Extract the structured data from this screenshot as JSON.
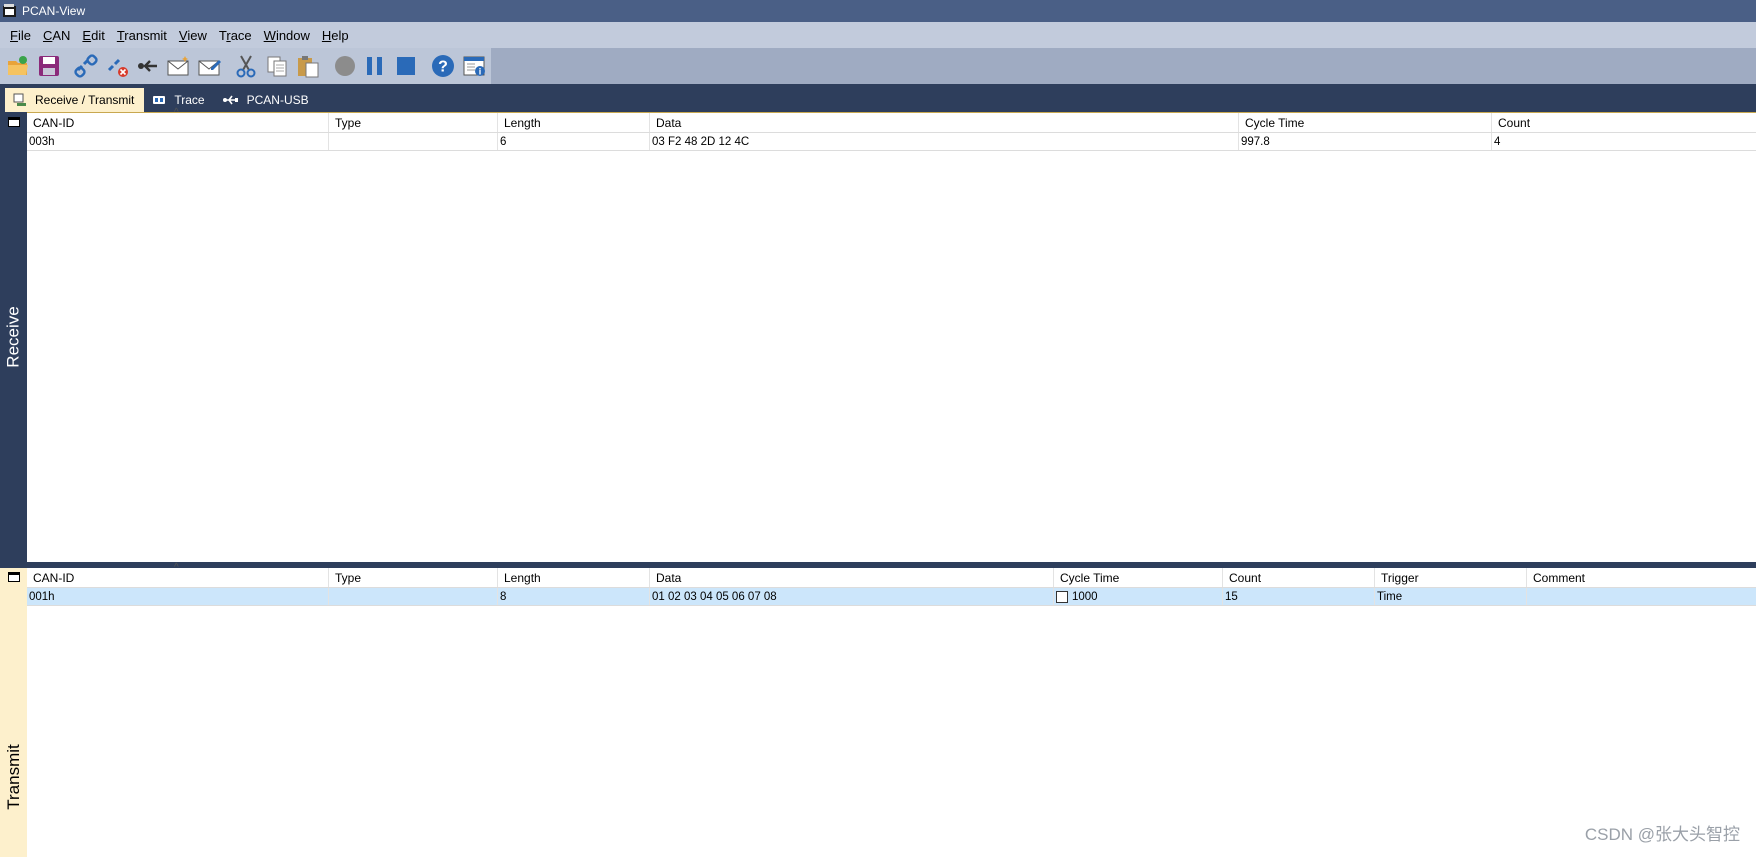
{
  "window": {
    "title": "PCAN-View"
  },
  "menu": [
    {
      "label": "File",
      "mnemonic": "F",
      "rest": "ile"
    },
    {
      "label": "CAN",
      "mnemonic": "C",
      "rest": "AN"
    },
    {
      "label": "Edit",
      "mnemonic": "E",
      "rest": "dit"
    },
    {
      "label": "Transmit",
      "mnemonic": "T",
      "rest": "ransmit"
    },
    {
      "label": "View",
      "mnemonic": "V",
      "rest": "iew"
    },
    {
      "label": "Trace",
      "mnemonic": "r",
      "prefix": "T",
      "rest": "ace"
    },
    {
      "label": "Window",
      "mnemonic": "W",
      "rest": "indow"
    },
    {
      "label": "Help",
      "mnemonic": "H",
      "rest": "elp"
    }
  ],
  "toolbar": {
    "icons": [
      "open-icon",
      "save-icon",
      "connect-icon",
      "disconnect-icon",
      "reset-icon",
      "new-message-icon",
      "edit-message-icon",
      "cut-icon",
      "copy-icon",
      "paste-icon",
      "record-icon",
      "pause-icon",
      "stop-icon",
      "help-icon",
      "about-icon"
    ]
  },
  "tabs": [
    {
      "label": "Receive / Transmit",
      "active": true
    },
    {
      "label": "Trace",
      "active": false
    },
    {
      "label": "PCAN-USB",
      "active": false
    }
  ],
  "receive": {
    "side_label": "Receive",
    "columns": [
      "CAN-ID",
      "Type",
      "Length",
      "Data",
      "Cycle Time",
      "Count"
    ],
    "rows": [
      {
        "can_id": "003h",
        "type": "",
        "length": "6",
        "data": "03 F2 48 2D 12 4C",
        "cycle_time": "997.8",
        "count": "4"
      }
    ]
  },
  "transmit": {
    "side_label": "Transmit",
    "columns": [
      "CAN-ID",
      "Type",
      "Length",
      "Data",
      "Cycle Time",
      "Count",
      "Trigger",
      "Comment"
    ],
    "rows": [
      {
        "can_id": "001h",
        "type": "",
        "length": "8",
        "data": "01 02 03 04 05 06 07 08",
        "cycle_checked": false,
        "cycle_time": "1000",
        "count": "15",
        "trigger": "Time",
        "comment": ""
      }
    ]
  },
  "watermark": "CSDN @张大头智控",
  "colors": {
    "titlebar": "#4a5f86",
    "dark_panel": "#2e3e5c",
    "active_tab": "#fdf0cc",
    "selected_row": "#cce6fb"
  }
}
